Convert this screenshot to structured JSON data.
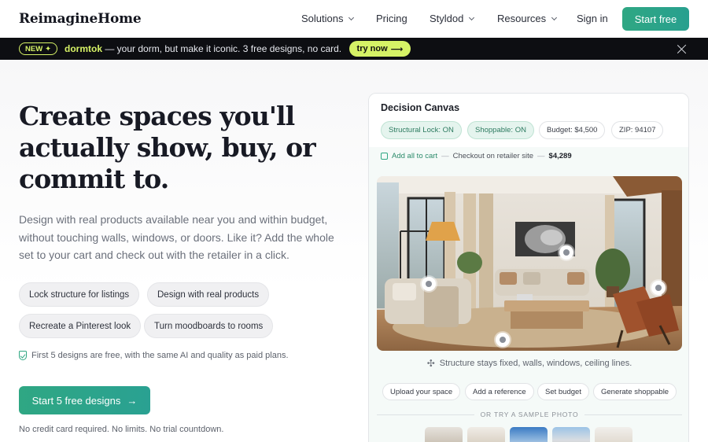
{
  "nav": {
    "logo": "ReimagineHome",
    "items": [
      {
        "label": "Solutions",
        "dropdown": true
      },
      {
        "label": "Pricing",
        "dropdown": false
      },
      {
        "label": "Styldod",
        "dropdown": true
      },
      {
        "label": "Resources",
        "dropdown": true
      }
    ],
    "sign_in": "Sign in",
    "start_free": "Start free"
  },
  "banner": {
    "badge": "NEW",
    "badge_icon": "✦",
    "brand": "dormtok",
    "text": " — your dorm, but make it iconic. 3 free designs, no card.",
    "try_label": "try now",
    "try_arrow": "⟶",
    "close_icon": "close-icon"
  },
  "hero": {
    "headline": "Create spaces you'll actually show, buy, or commit to.",
    "subtext": "Design with real products available near you and within budget, without touching walls, windows, or doors. Like it? Add the whole set to your cart and check out with the retailer in a click.",
    "pills": [
      "Lock structure for listings",
      "Design with real products",
      "Recreate a Pinterest look",
      "Turn moodboards to rooms"
    ],
    "free_note": "First 5 designs are free, with the same AI and quality as paid plans.",
    "cta_label": "Start 5 free designs",
    "cta_arrow": "→",
    "no_cc": "No credit card required. No limits. No trial countdown."
  },
  "canvas": {
    "title": "Decision Canvas",
    "chips": [
      {
        "label": "Structural Lock: ON",
        "active": true
      },
      {
        "label": "Shoppable: ON",
        "active": true
      },
      {
        "label": "Budget: $4,500",
        "active": false
      },
      {
        "label": "ZIP: 94107",
        "active": false
      }
    ],
    "cart": {
      "add_label": "Add all to cart",
      "separator": "—",
      "checkout_label": "Checkout on retailer site",
      "price": "$4,289"
    },
    "structure_note": "Structure stays fixed, walls, windows, ceiling lines.",
    "sparkle_icon": "✣",
    "actions": [
      "Upload your space",
      "Add a reference",
      "Set budget",
      "Generate shoppable"
    ],
    "or_label": "OR TRY A SAMPLE PHOTO"
  },
  "colors": {
    "accent": "#2fa783",
    "banner_bg": "#0d0e12",
    "banner_accent": "#d6f266",
    "chip_active_bg": "#e5f4ee"
  }
}
